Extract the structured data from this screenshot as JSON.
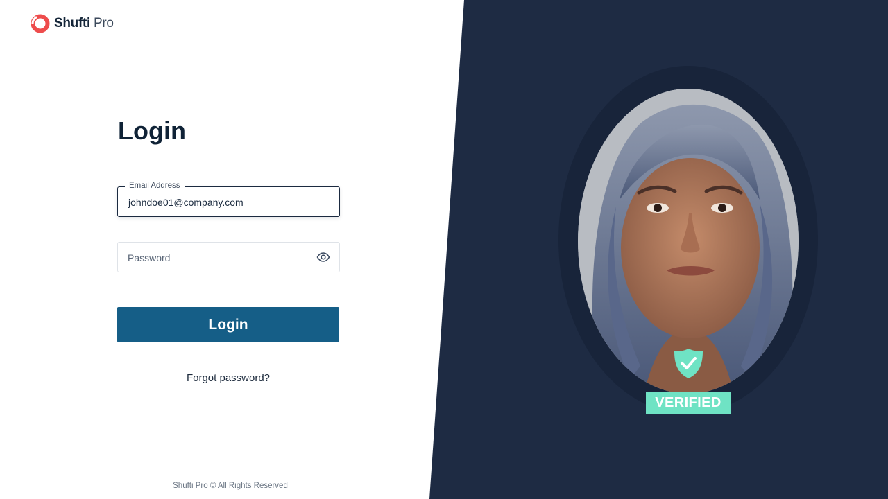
{
  "brand": {
    "name_bold": "Shufti",
    "name_light": "Pro",
    "accent": "#ee4c4c"
  },
  "login_form": {
    "title": "Login",
    "email": {
      "label": "Email Address",
      "value": "johndoe01@company.com"
    },
    "password": {
      "placeholder": "Password",
      "toggle_icon": "eye-icon"
    },
    "submit_label": "Login",
    "forgot_label": "Forgot password?"
  },
  "footer": {
    "text": "Shufti Pro © All Rights Reserved"
  },
  "hero": {
    "background": "#1e2b43",
    "badge_text": "VERIFIED",
    "badge_color": "#6fe3c4",
    "badge_icon": "shield-check-icon"
  },
  "colors": {
    "primary_button": "#155e87",
    "text_dark": "#0f2236"
  }
}
